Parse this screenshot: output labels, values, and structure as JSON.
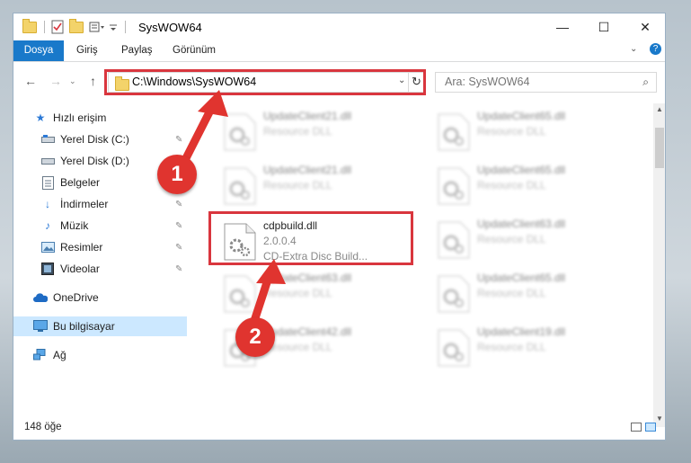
{
  "window": {
    "title": "SysWOW64",
    "controls": {
      "minimize": "—",
      "maximize": "☐",
      "close": "✕"
    }
  },
  "ribbon": {
    "tabs": [
      "Dosya",
      "Giriş",
      "Paylaş",
      "Görünüm"
    ],
    "expand_icon": "chevron-down-icon",
    "help_icon": "help-icon"
  },
  "address_bar": {
    "path": "C:\\Windows\\SysWOW64",
    "refresh_icon": "refresh-icon"
  },
  "search": {
    "placeholder": "Ara: SysWOW64"
  },
  "sidebar": {
    "quick_access": "Hızlı erişim",
    "items": [
      {
        "label": "Yerel Disk (C:)",
        "icon": "drive-icon",
        "pinned": true
      },
      {
        "label": "Yerel Disk (D:)",
        "icon": "drive-icon",
        "pinned": false
      },
      {
        "label": "Belgeler",
        "icon": "documents-icon",
        "pinned": true
      },
      {
        "label": "İndirmeler",
        "icon": "download-icon",
        "pinned": true
      },
      {
        "label": "Müzik",
        "icon": "music-icon",
        "pinned": true
      },
      {
        "label": "Resimler",
        "icon": "pictures-icon",
        "pinned": true
      },
      {
        "label": "Videolar",
        "icon": "videos-icon",
        "pinned": true
      }
    ],
    "onedrive": "OneDrive",
    "this_pc": "Bu bilgisayar",
    "network": "Ağ"
  },
  "files": {
    "left": [
      {
        "name": "UpdateClient21.dll",
        "desc": "Resource DLL"
      },
      {
        "name": "UpdateClient21.dll",
        "desc": "Resource DLL"
      },
      {
        "name": "cdpbuild.dll",
        "version": "2.0.0.4",
        "desc": "CD-Extra Disc Build..."
      },
      {
        "name": "UpdateClient63.dll",
        "desc": "Resource DLL"
      },
      {
        "name": "UpdateClient42.dll",
        "desc": "Resource DLL"
      }
    ],
    "right": [
      {
        "name": "UpdateClient65.dll",
        "desc": "Resource DLL"
      },
      {
        "name": "UpdateClient65.dll",
        "desc": "Resource DLL"
      },
      {
        "name": "UpdateClient63.dll",
        "desc": "Resource DLL"
      },
      {
        "name": "UpdateClient65.dll",
        "desc": "Resource DLL"
      },
      {
        "name": "UpdateClient19.dll",
        "desc": "Resource DLL"
      }
    ]
  },
  "status": {
    "count": "148 öğe"
  },
  "callouts": {
    "one": "1",
    "two": "2"
  },
  "colors": {
    "accent": "#1979ca",
    "highlight": "#d9363e",
    "selected": "#cce8ff"
  }
}
